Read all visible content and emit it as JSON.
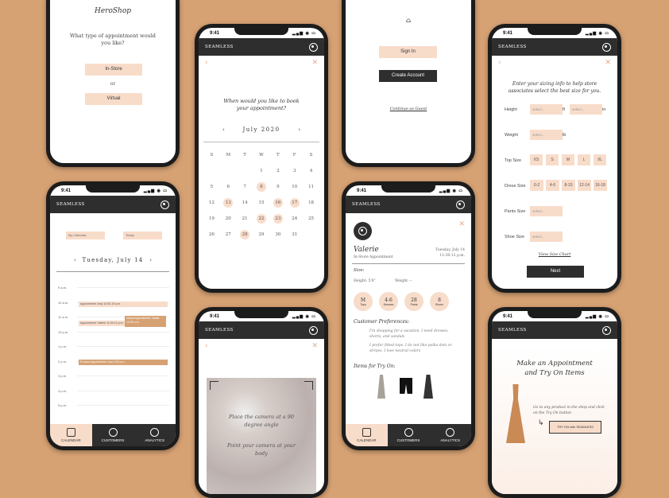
{
  "status_time": "9:41",
  "logo": "SEAMLESS",
  "p1": {
    "brand": "HeroShop",
    "question": "What type of appointment would you like?",
    "opt1": "In-Store",
    "or": "or",
    "opt2": "Virtual"
  },
  "p2": {
    "question": "When would you like to book your appointment?",
    "month": "July 2020",
    "weekdays": [
      "S",
      "M",
      "T",
      "W",
      "T",
      "F",
      "S"
    ],
    "days": [
      "",
      "",
      "",
      "1",
      "2",
      "3",
      "4",
      "5",
      "6",
      "7",
      "8",
      "9",
      "10",
      "11",
      "12",
      "13",
      "14",
      "15",
      "16",
      "17",
      "18",
      "19",
      "20",
      "21",
      "22",
      "23",
      "24",
      "25",
      "26",
      "27",
      "28",
      "29",
      "30",
      "31",
      ""
    ],
    "highlighted": [
      "8",
      "13",
      "16",
      "17",
      "22",
      "23",
      "28"
    ]
  },
  "p3": {
    "sign_in": "Sign In",
    "create": "Create Account",
    "guest": "Continue as Guest"
  },
  "p4": {
    "intro": "Enter your sizing info to help store associates select the best size for you.",
    "height": "Height",
    "weight": "Weight",
    "top": "Top Size",
    "dress": "Dress Size",
    "pants": "Pants Size",
    "shoe": "Shoe Size",
    "select": "select...",
    "ft": "ft",
    "in": "in",
    "lb": "lb",
    "top_sizes": [
      "XS",
      "S",
      "M",
      "L",
      "XL"
    ],
    "dress_sizes": [
      "0-2",
      "4-6",
      "8-10",
      "12-14",
      "16-18"
    ],
    "view_chart": "View Size Chart",
    "next": "Next"
  },
  "p5": {
    "filter1": "My Calendar",
    "filter2": "Today",
    "date": "Tuesday, July 14",
    "times": [
      "9 a.m.",
      "10 a.m.",
      "11 a.m.",
      "12 p.m.",
      "1 p.m.",
      "2 p.m.",
      "3 p.m.",
      "4 p.m.",
      "5 p.m."
    ],
    "ev1": "Appointment: Amy 10:00-10 a.m.",
    "ev2": "Appointment: Valerie 11:30-12 p.m.",
    "ev3": "Virtual Appointment: Nadia 10:30 a.m.",
    "ev4": "Product Appointment: Lisa 2:00 p.m.",
    "tabs": [
      "CALENDAR",
      "CUSTOMERS",
      "ANALYTICS"
    ]
  },
  "p6": {
    "name": "Valerie",
    "sub": "In-Store Appointment",
    "date": "Tuesday, July 14",
    "time": "11:30-12 p.m.",
    "size": "Size:",
    "height": "Height: 5'8\"",
    "weight": "Weight: --",
    "sizes": [
      {
        "v": "M",
        "l": "Tops"
      },
      {
        "v": "4-6",
        "l": "Dresses"
      },
      {
        "v": "28",
        "l": "Pants"
      },
      {
        "v": "8",
        "l": "Shoes"
      }
    ],
    "prefs": "Customer Preferences:",
    "pref1": "I'm shopping for a vacation. I need dresses, shorts, and sandals",
    "pref2": "I prefer fitted tops. I do not like polka dots or stripes. I love neutral colors",
    "items": "Items for Try On:"
  },
  "p7": {
    "line1": "Place the camera at a 90 degree angle",
    "line2": "Point your camera at your body"
  },
  "p8": {
    "title": "Make an Appointment and Try On Items",
    "desc": "Go to any product in the shop and click on the Try On button",
    "btn": "TRY ON with SEAMLESS"
  }
}
